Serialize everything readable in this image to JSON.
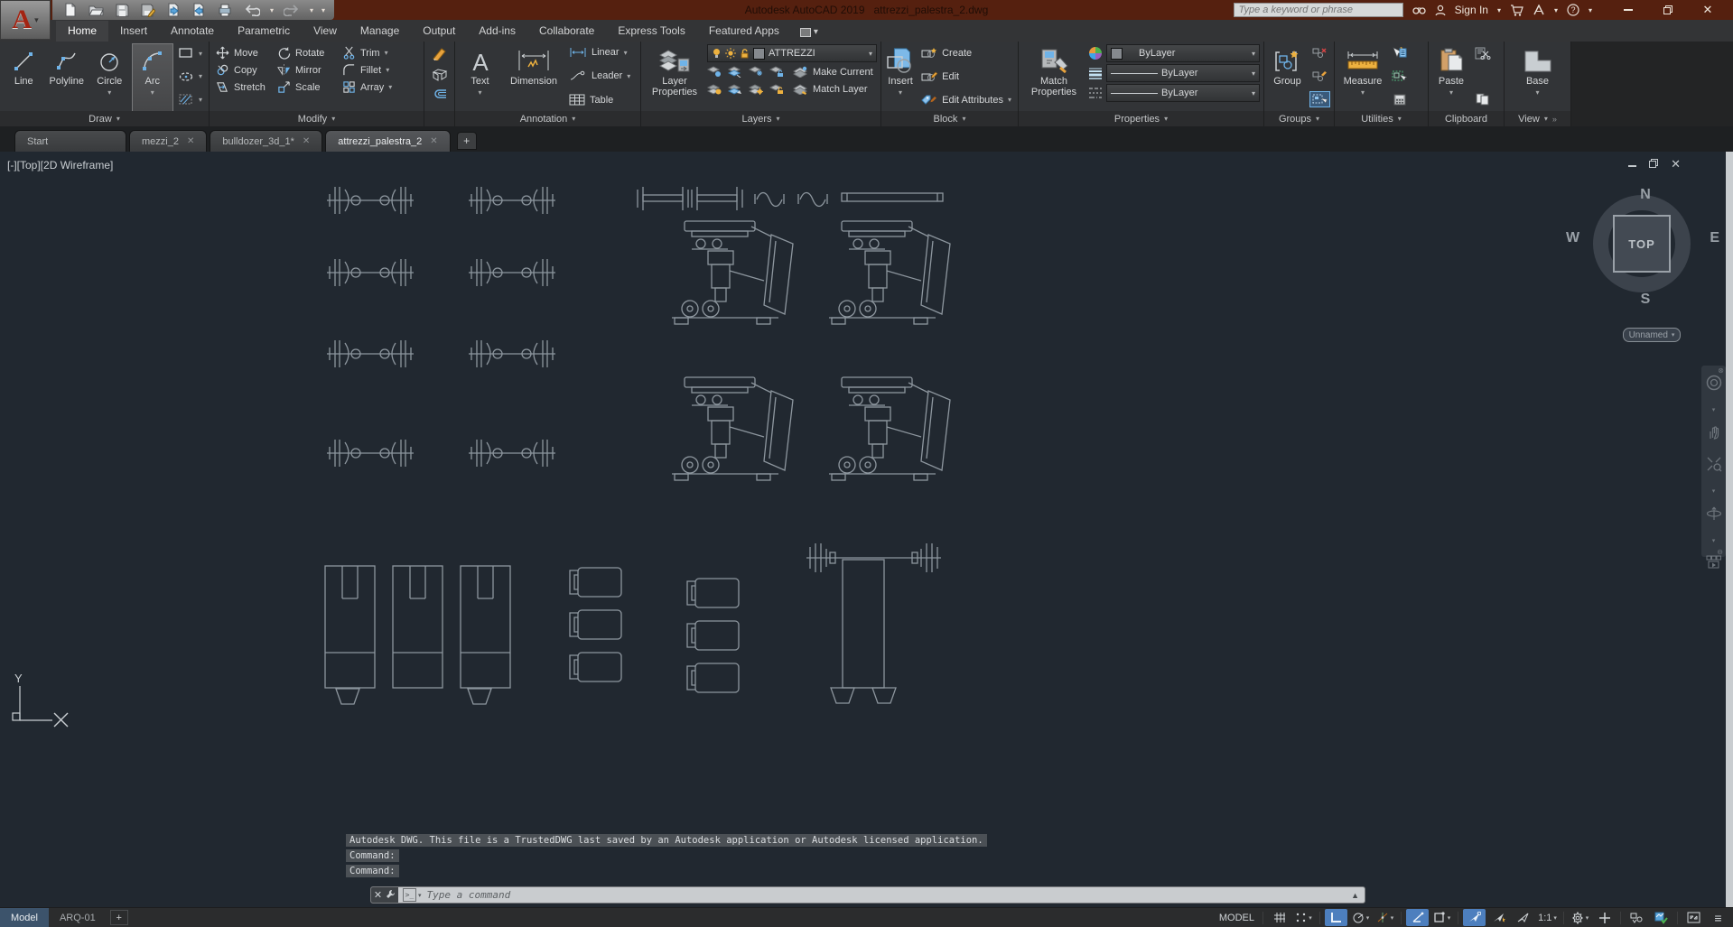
{
  "titlebar": {
    "app_title": "Autodesk AutoCAD 2019   attrezzi_palestra_2.dwg",
    "search_placeholder": "Type a keyword or phrase",
    "sign_in_label": "Sign In"
  },
  "ribbon": {
    "tabs": [
      "Home",
      "Insert",
      "Annotate",
      "Parametric",
      "View",
      "Manage",
      "Output",
      "Add-ins",
      "Collaborate",
      "Express Tools",
      "Featured Apps"
    ],
    "draw": {
      "line": "Line",
      "polyline": "Polyline",
      "circle": "Circle",
      "arc": "Arc",
      "footer": "Draw"
    },
    "modify": {
      "move": "Move",
      "rotate": "Rotate",
      "trim": "Trim",
      "copy": "Copy",
      "mirror": "Mirror",
      "fillet": "Fillet",
      "stretch": "Stretch",
      "scale": "Scale",
      "array": "Array",
      "footer": "Modify"
    },
    "annotation": {
      "text": "Text",
      "dimension": "Dimension",
      "linear": "Linear",
      "leader": "Leader",
      "table": "Table",
      "footer": "Annotation"
    },
    "layers": {
      "layer_properties": "Layer Properties",
      "current_layer": "ATTREZZI",
      "make_current": "Make Current",
      "match_layer": "Match Layer",
      "footer": "Layers"
    },
    "block": {
      "insert": "Insert",
      "create": "Create",
      "edit": "Edit",
      "edit_attributes": "Edit Attributes",
      "footer": "Block"
    },
    "properties": {
      "match_properties": "Match Properties",
      "color_value": "ByLayer",
      "lineweight_value": "ByLayer",
      "linetype_value": "ByLayer",
      "footer": "Properties"
    },
    "groups": {
      "group": "Group",
      "footer": "Groups"
    },
    "utilities": {
      "measure": "Measure",
      "footer": "Utilities"
    },
    "clipboard": {
      "paste": "Paste",
      "footer": "Clipboard"
    },
    "view": {
      "base": "Base",
      "footer": "View"
    }
  },
  "file_tabs": [
    "Start",
    "mezzi_2",
    "bulldozer_3d_1*",
    "attrezzi_palestra_2"
  ],
  "viewport": {
    "label": "[-][Top][2D Wireframe]",
    "viewcube": {
      "n": "N",
      "s": "S",
      "e": "E",
      "w": "W",
      "top": "TOP",
      "view_name": "Unnamed"
    }
  },
  "command": {
    "history1": "Autodesk DWG.  This file is a TrustedDWG last saved by an Autodesk application or Autodesk licensed application.",
    "history2": "Command:",
    "history3": "Command:",
    "placeholder": "Type a command"
  },
  "statusbar": {
    "model_tab": "Model",
    "layout_tab": "ARQ-01",
    "add_layout": "+",
    "model_space": "MODEL",
    "annotation_scale": "1:1"
  },
  "colors": {
    "titlebar": "#55200f",
    "canvas": "#212830",
    "accent_blue": "#4d7fbe",
    "drawing_stroke": "#8d969e"
  }
}
